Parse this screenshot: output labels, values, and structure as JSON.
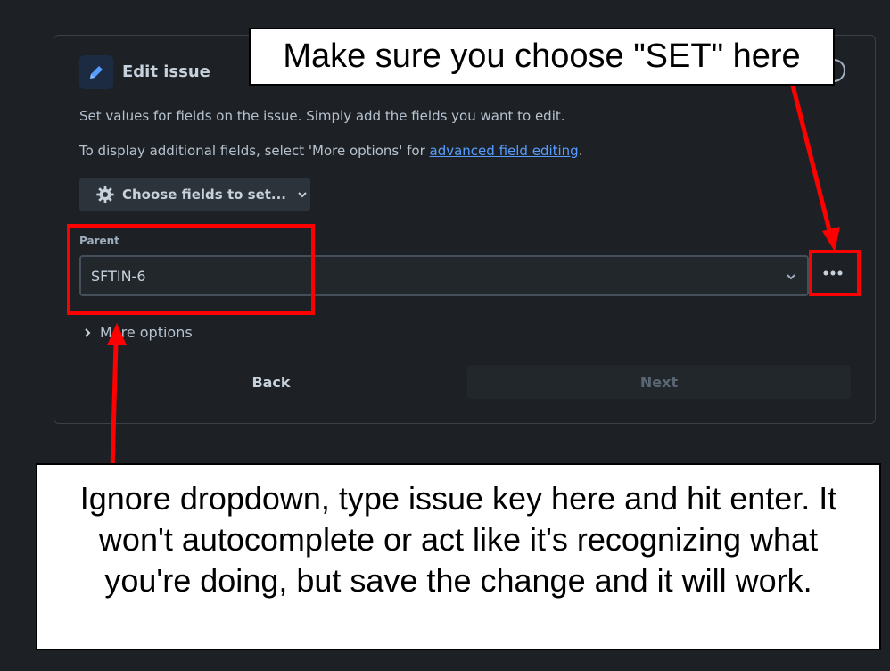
{
  "dialog": {
    "title": "Edit issue",
    "description_line1": "Set values for fields on the issue. Simply add the fields you want to edit.",
    "description_line2_prefix": "To display additional fields, select 'More options' for ",
    "description_line2_link": "advanced field editing",
    "description_line2_suffix": ".",
    "choose_fields_label": "Choose fields to set...",
    "parent_field": {
      "label": "Parent",
      "value": "SFTIN-6"
    },
    "more_options_label": "More options",
    "back_label": "Back",
    "next_label": "Next"
  },
  "annotations": {
    "top_callout": "Make sure you choose \"SET\" here",
    "bottom_callout": "Ignore dropdown, type issue key here and hit enter. It won't autocomplete or act like it's recognizing what you're doing, but save the change and it will work.",
    "highlight_color": "#ff0000"
  },
  "icons": {
    "edit": "pencil-icon",
    "help": "help-icon",
    "settings": "gear-icon",
    "dropdown": "chevron-down-icon",
    "more": "more-dots-icon",
    "expand": "chevron-right-icon"
  },
  "colors": {
    "background": "#1d2125",
    "link": "#579dff",
    "icon_accent": "#579dff"
  }
}
